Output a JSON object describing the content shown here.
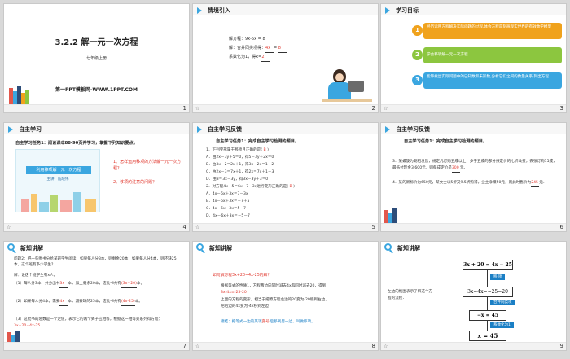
{
  "slides": [
    {
      "number": "1",
      "title": "3.2.2 解一元一次方程",
      "subtitle": "七年级上册",
      "credit": "第一PPT模板网-WWW.1PPT.COM"
    },
    {
      "number": "2",
      "heading": "情境引入",
      "line1": "解方程：9x-5x = 8",
      "line2a": "解：合并同类项得：",
      "line2b": "4x",
      "line2c": "= ",
      "line2d": "8",
      "line3a": "系数化为1，得x=",
      "line3b": "2"
    },
    {
      "number": "3",
      "heading": "学习目标",
      "goals": [
        {
          "n": "1",
          "text": "经历运用方程解决实际问题的过程,体会方程是刻画现实世界的有效数学模型",
          "color": "#f0a21c"
        },
        {
          "n": "2",
          "text": "学会移项解一元一次方程",
          "color": "#8cc63f"
        },
        {
          "n": "3",
          "text": "能够找出实际问题中的已知数和未知数,分析它们之间的数量关系,列出方程",
          "color": "#3aa6e0"
        }
      ]
    },
    {
      "number": "4",
      "heading": "自主学习",
      "task": "自主学习任务1：阅读课本88-90页并学习，掌握下列知识要点。",
      "card_title": "利用移项解一元一次方程",
      "card_sub": "主讲：成晓伟",
      "q1": "1、怎样运用移项的方法解一元一次方程？",
      "q2": "2、移项的注意的问题？"
    },
    {
      "number": "5",
      "heading": "自主学习反馈",
      "task": "自主学习任务1：完成自主学习检测的题目。",
      "lines": [
        {
          "t": "1．下列变形属于移项且正确的是(  ",
          "a": "B",
          "e": "  )"
        },
        {
          "t": "A．由2x－3y＋5＝0，得5－3y＋2x＝0",
          "a": "",
          "e": ""
        },
        {
          "t": "B．由3x－2＝2x＋1，得3x－2x＝1＋2",
          "a": "",
          "e": ""
        },
        {
          "t": "C．由2x－3＝7x＋1，得2x＝7x＋1－3",
          "a": "",
          "e": ""
        },
        {
          "t": "D．由3＝3x－3y，得3x－3y＋3＝0",
          "a": "",
          "e": ""
        },
        {
          "t": "2．对方程4x－5＝6x－7－3x进行变形正确的是(  ",
          "a": "B",
          "e": "  )"
        },
        {
          "t": "A．4x－6x＋3x＝7－3x",
          "a": "",
          "e": ""
        },
        {
          "t": "B．4x－6x＋3x＝－7＋5",
          "a": "",
          "e": ""
        },
        {
          "t": "C．4x－6x－3x＝5－7",
          "a": "",
          "e": ""
        },
        {
          "t": "D．4x－6x＋3x＝－5－7",
          "a": "",
          "e": ""
        }
      ]
    },
    {
      "number": "6",
      "heading": "自主学习反馈",
      "task": "自主学习任务1：完成自主学习检测的题目。",
      "p1": "3．某螺旋为期租发售，规定凡订购五成以上，多于五成的部分按定价的七折收费，去张订购15成，最低付现金3 600元，则每成定价是",
      "a1": "300",
      "p1e": "元．",
      "p2": "4．某的新标价为650元，某文士以5折又9.5折购得，业主净赚50元，则此时售价为",
      "a2": "245",
      "p2e": "元．"
    },
    {
      "number": "7",
      "heading": "新知讲解",
      "p1": "问题2：把一些图书分给某班学生阅读，如果每人分3本，则剩余20本；如果每人分4本，则还缺25本，这个班有多少学生？",
      "p2": "解：设这个班学生有x人，",
      "p3a": "（1）每人分3本，共分出书",
      "p3b": "3x",
      "p3c": "本，加上剩余20本，这批书共有",
      "p3d": "(3x+20)",
      "p3e": "本；",
      "p4a": "（2）如果每人分4本，需要",
      "p4b": "4x",
      "p4c": "本，减去缺的25本，这批书共有",
      "p4d": "(4x-25)",
      "p4e": "本。",
      "p5": "（3）这批书的总数是一个定值，表示它的两个式子应相等，根据这一相等关系列得方程：",
      "p5a": "3x+20=4x-25"
    },
    {
      "number": "8",
      "heading": "新知讲解",
      "q": "如何解方程3x+20=4x-25的解？",
      "p1": "根据等式的性质1，方程两边向同时减去4x再同时减去20，得到：",
      "eq": "3x-4x=-25-20",
      "p2": "上面的方程的变形，相当于把原方程左边的20变为-20移到右边，",
      "p3": "把右边的4x变为-4x移到左边",
      "note_a": "總結：把等式一边的某项",
      "note_b": "变号",
      "note_c": "后移到另一边，叫做移项。"
    },
    {
      "number": "9",
      "heading": "新知讲解",
      "side": "左边的框图表示了解这个方程的流程．",
      "steps": [
        "3x + 20 = 4x − 25",
        "3x−4x=−25−20",
        "−x = 45",
        "x = 45"
      ],
      "tags": [
        "移    项",
        "合并同类项",
        "系数化为1"
      ]
    }
  ]
}
